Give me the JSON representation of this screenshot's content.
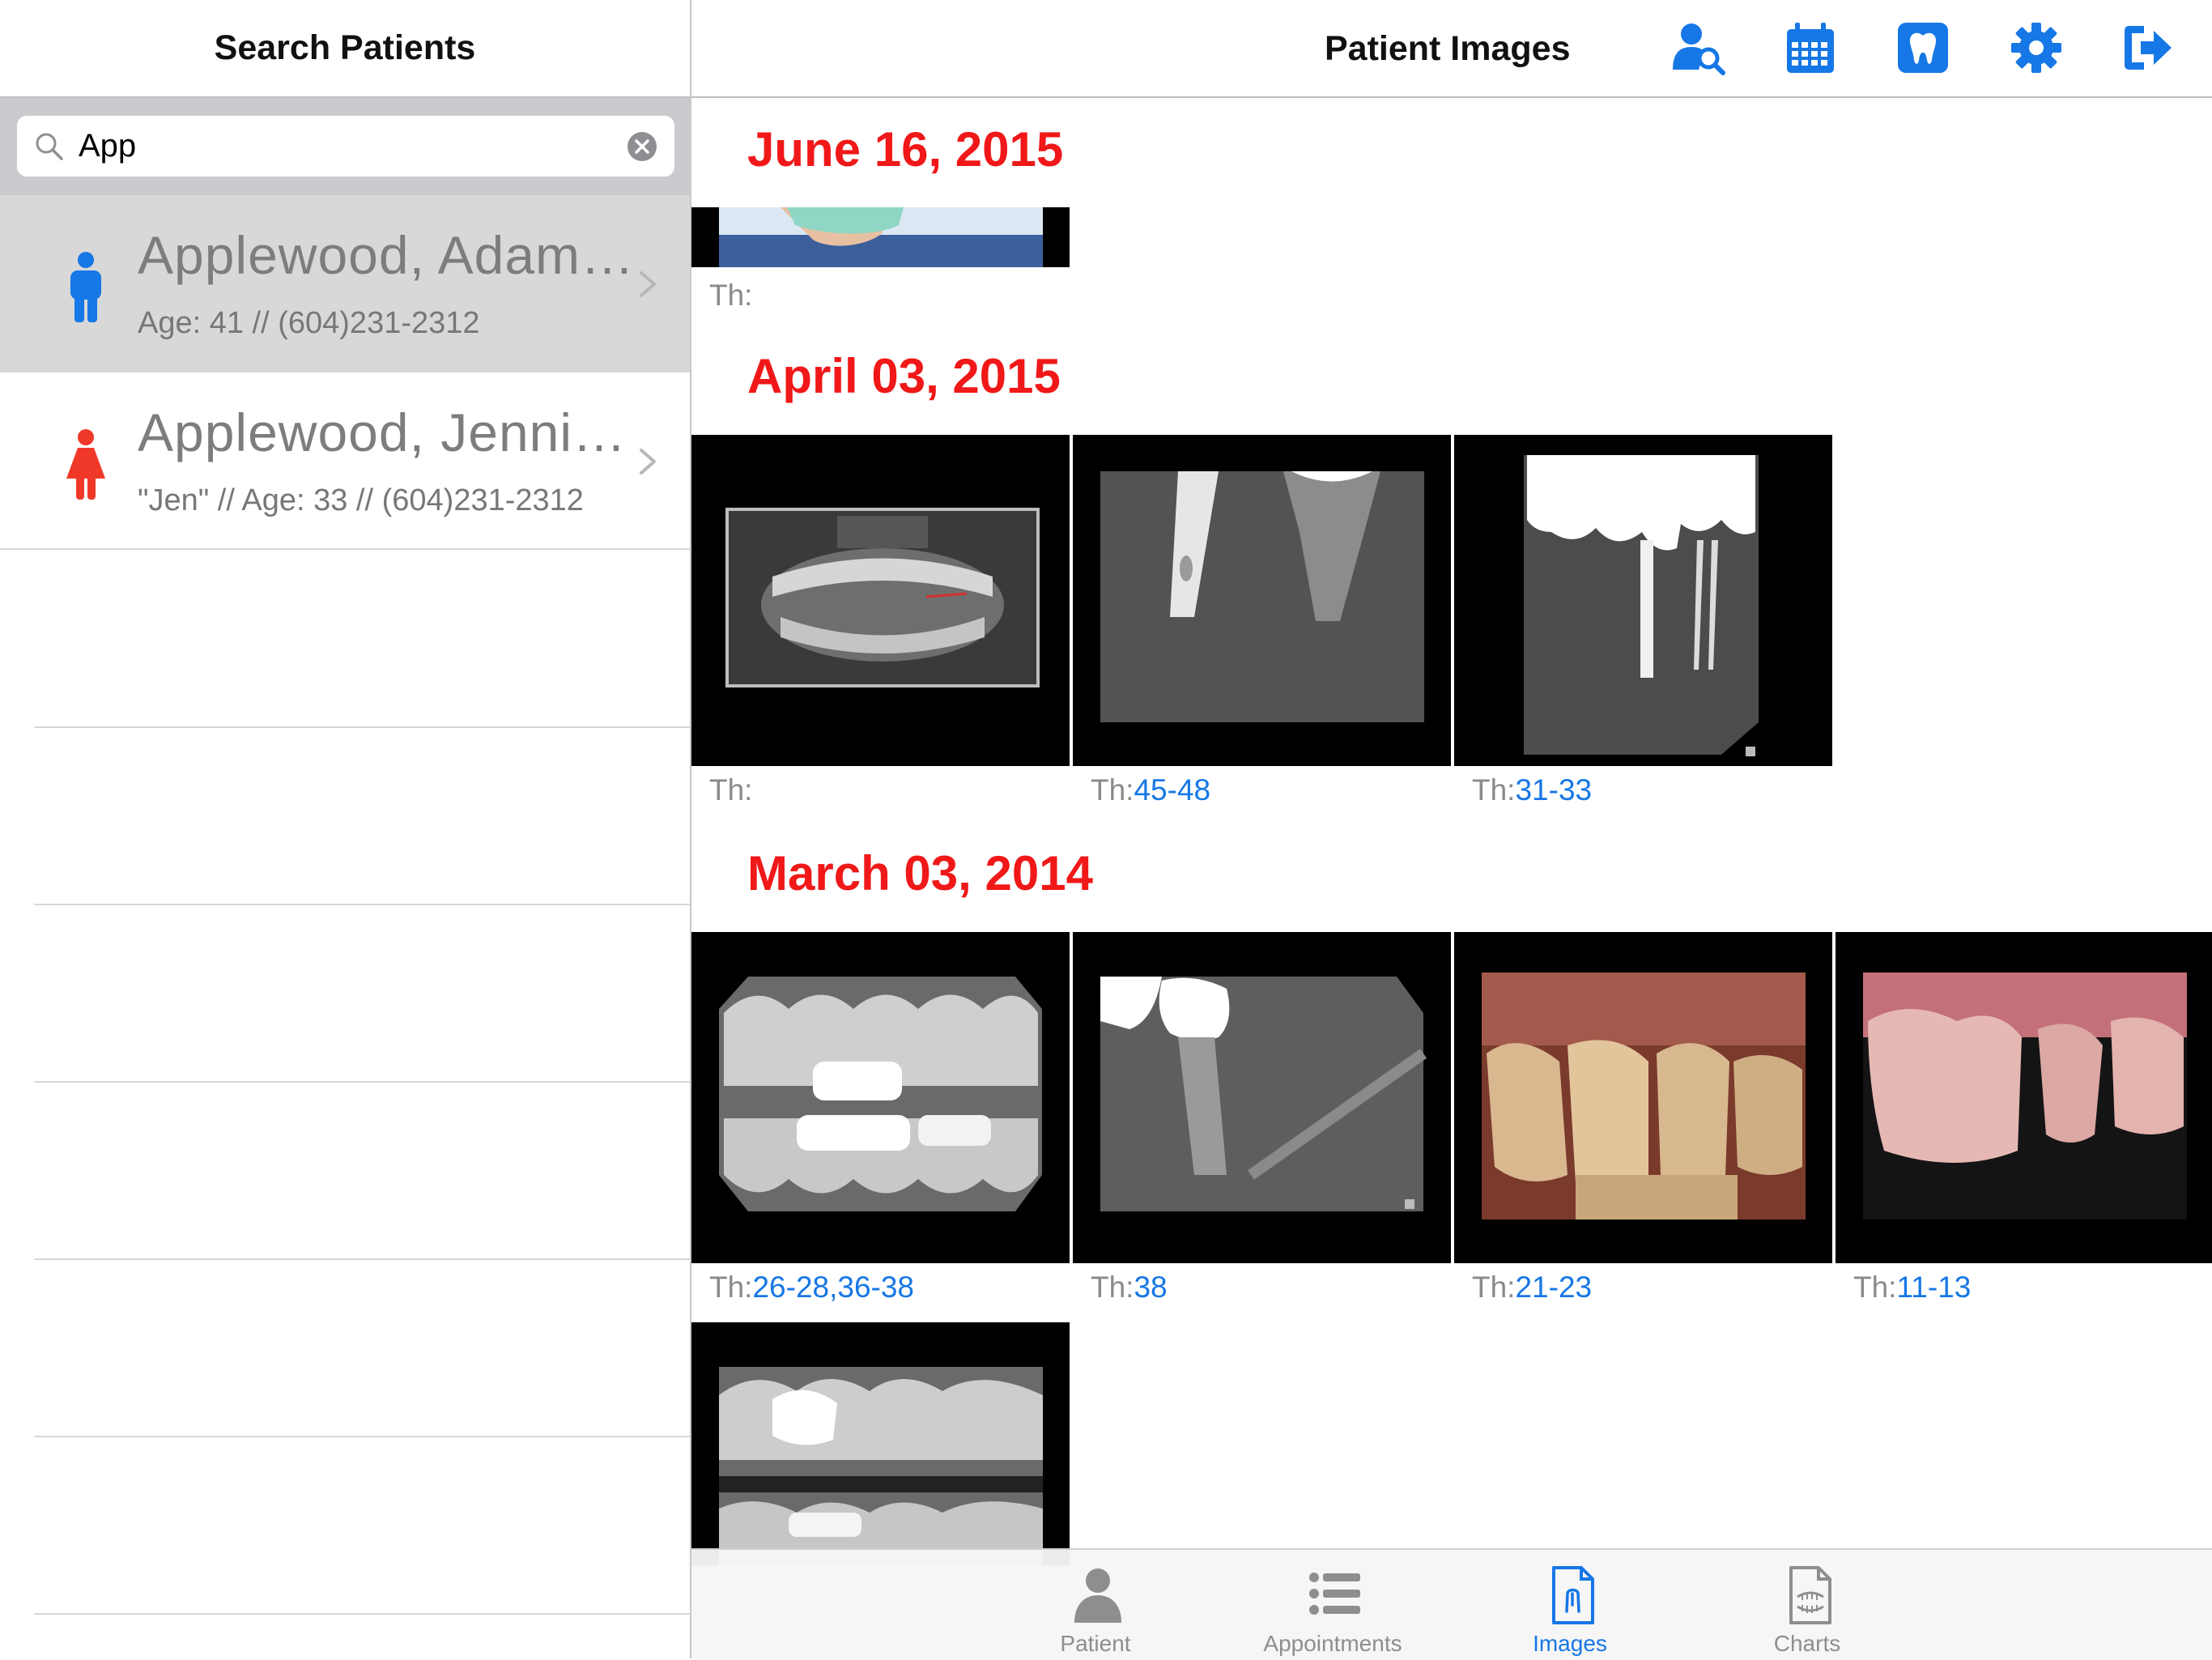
{
  "left_panel": {
    "title": "Search Patients",
    "search": {
      "value": "App"
    },
    "patients": [
      {
        "name": "Applewood, Adam…",
        "info": "Age: 41 // (604)231-2312",
        "gender": "male",
        "selected": true
      },
      {
        "name": "Applewood, Jenni…",
        "info": "\"Jen\" // Age: 33 // (604)231-2312",
        "gender": "female",
        "selected": false
      }
    ]
  },
  "header": {
    "title": "Patient Images",
    "icons": [
      "patient-search-icon",
      "calendar-icon",
      "tooth-icon",
      "gear-icon",
      "logout-icon"
    ]
  },
  "groups": [
    {
      "date": "June 16, 2015",
      "images": [
        {
          "prefix": "Th:",
          "teeth": ""
        }
      ]
    },
    {
      "date": "April 03, 2015",
      "images": [
        {
          "prefix": "Th:",
          "teeth": ""
        },
        {
          "prefix": "Th:",
          "teeth": "45-48"
        },
        {
          "prefix": "Th:",
          "teeth": "31-33"
        }
      ]
    },
    {
      "date": "March 03, 2014",
      "images": [
        {
          "prefix": "Th:",
          "teeth": "26-28,36-38"
        },
        {
          "prefix": "Th:",
          "teeth": "38"
        },
        {
          "prefix": "Th:",
          "teeth": "21-23"
        },
        {
          "prefix": "Th:",
          "teeth": "11-13"
        }
      ]
    }
  ],
  "tabs": [
    {
      "label": "Patient",
      "active": false
    },
    {
      "label": "Appointments",
      "active": false
    },
    {
      "label": "Images",
      "active": true
    },
    {
      "label": "Charts",
      "active": false
    }
  ],
  "colors": {
    "accent": "#1677e6",
    "date": "#f01818",
    "male": "#1677e6",
    "female": "#f03828"
  }
}
